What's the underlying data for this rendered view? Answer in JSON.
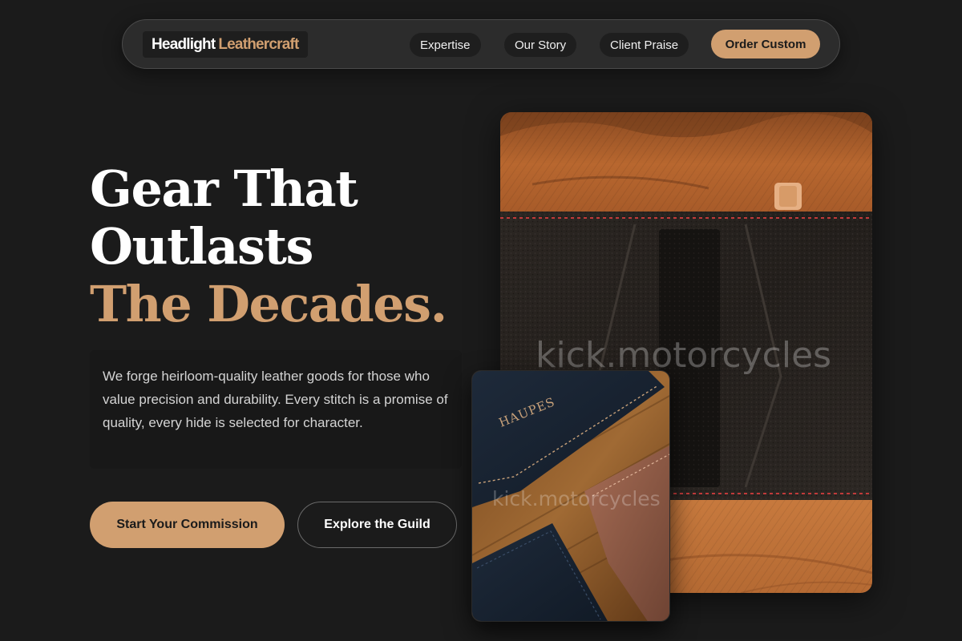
{
  "nav": {
    "brand_part1": "Headlight",
    "brand_part2": "Leathercraft",
    "links": [
      {
        "label": "Expertise"
      },
      {
        "label": "Our Story"
      },
      {
        "label": "Client Praise"
      }
    ],
    "cta_label": "Order Custom"
  },
  "hero": {
    "headline_line1": "Gear That",
    "headline_line2": "Outlasts",
    "headline_line3": "The Decades.",
    "description": "We forge heirloom-quality leather goods for those who value precision and durability. Every stitch is a promise of quality, every hide is selected for character.",
    "primary_button": "Start Your Commission",
    "secondary_button": "Explore the Guild"
  },
  "images": {
    "watermark_main": "kick.motorcycles",
    "watermark_secondary": "kick.motorcycles",
    "wallet_emboss": "HAUPES"
  },
  "colors": {
    "background": "#1b1b1b",
    "accent": "#d19f70",
    "nav_bg": "#2c2c2c"
  }
}
